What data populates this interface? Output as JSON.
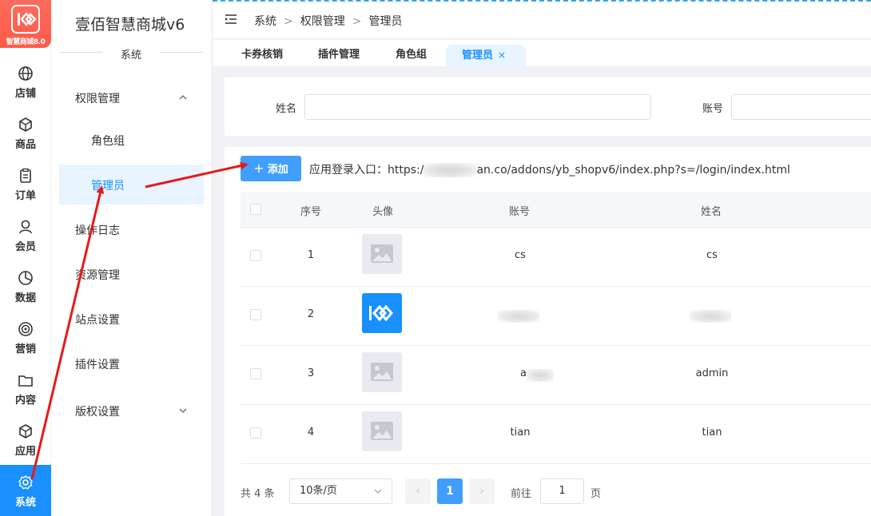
{
  "brand": {
    "logo_text": "智慧商城8.0",
    "name": "壹佰智慧商城v6"
  },
  "rail": [
    {
      "label": "店铺",
      "icon": "globe-icon"
    },
    {
      "label": "商品",
      "icon": "box-icon"
    },
    {
      "label": "订单",
      "icon": "clipboard-icon"
    },
    {
      "label": "会员",
      "icon": "user-icon"
    },
    {
      "label": "数据",
      "icon": "pie-chart-icon"
    },
    {
      "label": "营销",
      "icon": "target-icon"
    },
    {
      "label": "内容",
      "icon": "folder-icon"
    },
    {
      "label": "应用",
      "icon": "cube-icon"
    },
    {
      "label": "系统",
      "icon": "gear-icon",
      "active": true
    }
  ],
  "sidebar": {
    "section_title": "系统",
    "groups": [
      "权限管理",
      "操作日志",
      "资源管理",
      "站点设置",
      "插件设置",
      "版权设置"
    ],
    "sub_items": [
      "角色组",
      "管理员"
    ]
  },
  "breadcrumb": [
    "系统",
    "权限管理",
    "管理员"
  ],
  "tabs": [
    {
      "label": "卡券核销"
    },
    {
      "label": "插件管理"
    },
    {
      "label": "角色组"
    },
    {
      "label": "管理员",
      "active": true,
      "close": "×"
    }
  ],
  "search": {
    "name_label": "姓名",
    "account_label": "账号"
  },
  "toolbar": {
    "add_label": "添加",
    "add_icon": "+",
    "login_prefix": "应用登录入口：https:/",
    "login_suffix": "an.co/addons/yb_shopv6/index.php?s=/login/index.html"
  },
  "table": {
    "headers": [
      "序号",
      "头像",
      "账号",
      "姓名"
    ],
    "rows": [
      {
        "index": "1",
        "avatar": "placeholder",
        "account": "cs",
        "name": "cs"
      },
      {
        "index": "2",
        "avatar": "logo",
        "account": "",
        "name": ""
      },
      {
        "index": "3",
        "avatar": "placeholder",
        "account": "a",
        "name": "admin"
      },
      {
        "index": "4",
        "avatar": "placeholder",
        "account": "tian",
        "name": "tian"
      }
    ]
  },
  "pagination": {
    "total": "共 4 条",
    "page_size": "10条/页",
    "prev": "‹",
    "current": "1",
    "next": "›",
    "goto_label": "前往",
    "goto_value": "1",
    "page_unit": "页"
  },
  "colors": {
    "primary": "#1890ff",
    "button": "#409eff",
    "logo_bg": "#ff5a4a",
    "annotation": "#e8191a"
  }
}
